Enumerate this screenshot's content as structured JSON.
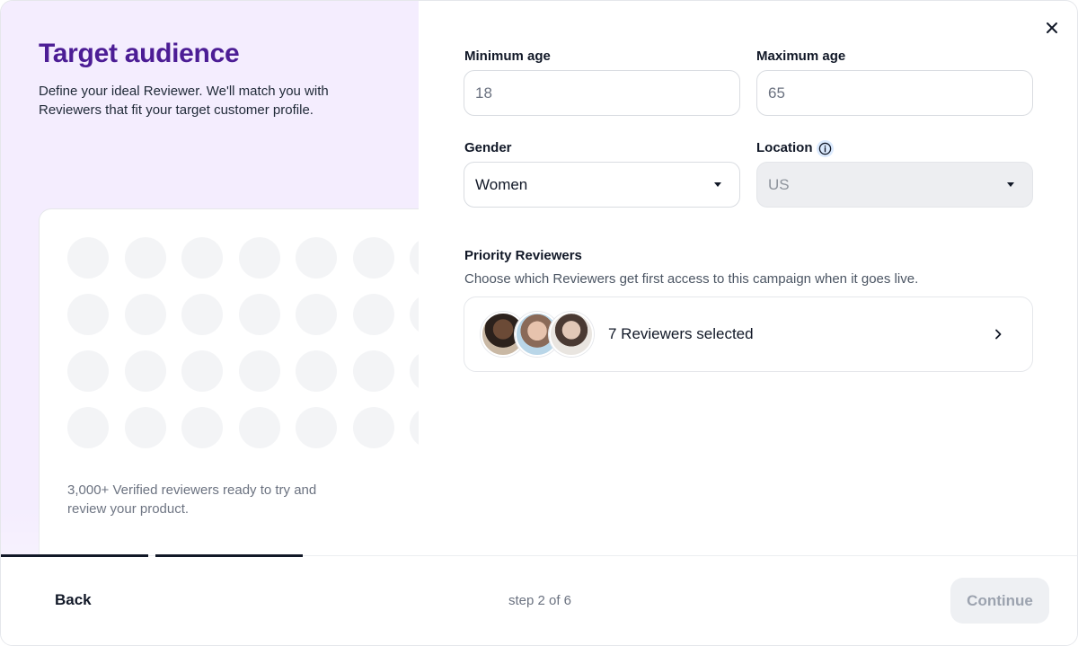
{
  "left": {
    "title": "Target audience",
    "subtitle": "Define your ideal Reviewer. We'll match you with Reviewers that fit your target customer profile.",
    "card_text": "3,000+ Verified reviewers ready to try and review your product."
  },
  "form": {
    "min_age": {
      "label": "Minimum age",
      "value": "18"
    },
    "max_age": {
      "label": "Maximum age",
      "value": "65"
    },
    "gender": {
      "label": "Gender",
      "value": "Women"
    },
    "location": {
      "label": "Location",
      "value": "US",
      "disabled": true
    }
  },
  "priority": {
    "title": "Priority Reviewers",
    "description": "Choose which Reviewers get first access to this campaign when it goes live.",
    "selected_label": "7 Reviewers selected"
  },
  "footer": {
    "back_label": "Back",
    "step_label": "step 2 of 6",
    "continue_label": "Continue",
    "current_step": 2,
    "total_steps": 6
  },
  "icons": {
    "close": "close-icon",
    "info": "info-icon",
    "dropdown": "chevron-down-icon",
    "chevron": "chevron-right-icon"
  },
  "colors": {
    "accent": "#4c1d95",
    "left_background": "#f4edfe",
    "info": "#dbeafe"
  }
}
